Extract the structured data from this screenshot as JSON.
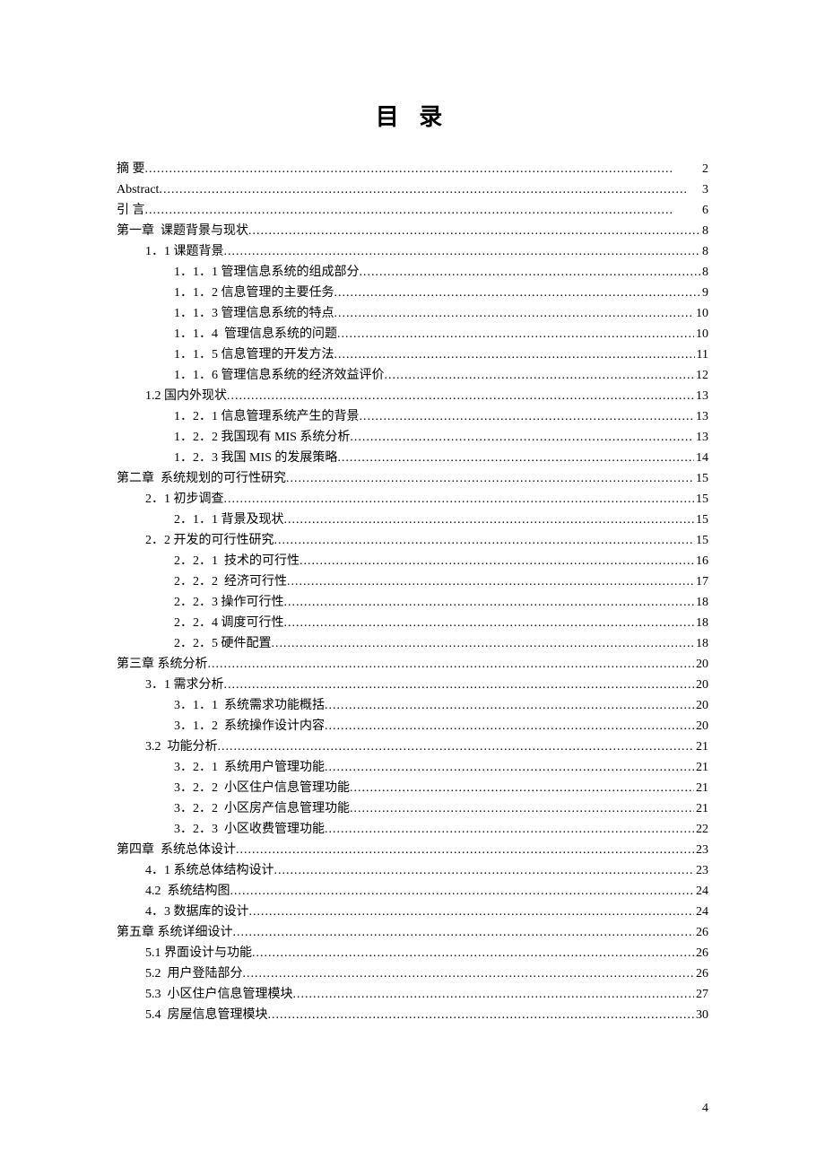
{
  "title": "目 录",
  "page_number": "4",
  "toc": [
    {
      "indent": 0,
      "label": "摘 要",
      "page": "2"
    },
    {
      "indent": 0,
      "label": "Abstract",
      "page": "3"
    },
    {
      "indent": 0,
      "label": "引 言",
      "page": "6"
    },
    {
      "indent": 0,
      "label": "第一章  课题背景与现状",
      "page": "8"
    },
    {
      "indent": 1,
      "label": "1．1 课题背景",
      "page": "8"
    },
    {
      "indent": 2,
      "label": "1．1．1 管理信息系统的组成部分",
      "page": "8"
    },
    {
      "indent": 2,
      "label": "1．1．2 信息管理的主要任务",
      "page": "9"
    },
    {
      "indent": 2,
      "label": "1．1．3 管理信息系统的特点",
      "page": "10"
    },
    {
      "indent": 2,
      "label": "1．1．4  管理信息系统的问题",
      "page": "10"
    },
    {
      "indent": 2,
      "label": "1．1．5 信息管理的开发方法",
      "page": "11"
    },
    {
      "indent": 2,
      "label": "1．1．6 管理信息系统的经济效益评价",
      "page": "12"
    },
    {
      "indent": 1,
      "label": "1.2 国内外现状",
      "page": "13"
    },
    {
      "indent": 2,
      "label": "1．2．1 信息管理系统产生的背景",
      "page": "13"
    },
    {
      "indent": 2,
      "label": "1．2．2 我国现有 MIS 系统分析",
      "page": "13"
    },
    {
      "indent": 2,
      "label": "1．2．3 我国 MIS 的发展策略",
      "page": "14"
    },
    {
      "indent": 0,
      "label": "第二章  系统规划的可行性研究",
      "page": "15"
    },
    {
      "indent": 1,
      "label": "2．1 初步调查",
      "page": "15"
    },
    {
      "indent": 2,
      "label": "2．1．1 背景及现状",
      "page": "15"
    },
    {
      "indent": 1,
      "label": "2．2 开发的可行性研究",
      "page": "15"
    },
    {
      "indent": 2,
      "label": "2．2．1  技术的可行性",
      "page": "16"
    },
    {
      "indent": 2,
      "label": "2．2．2  经济可行性",
      "page": "17"
    },
    {
      "indent": 2,
      "label": "2．2．3 操作可行性",
      "page": "18"
    },
    {
      "indent": 2,
      "label": "2．2．4 调度可行性",
      "page": "18"
    },
    {
      "indent": 2,
      "label": "2．2．5 硬件配置",
      "page": "18"
    },
    {
      "indent": 0,
      "label": "第三章 系统分析",
      "page": "20"
    },
    {
      "indent": 1,
      "label": "3．1 需求分析",
      "page": "20"
    },
    {
      "indent": 2,
      "label": "3．1．1  系统需求功能概括",
      "page": "20"
    },
    {
      "indent": 2,
      "label": "3．1．2  系统操作设计内容",
      "page": "20"
    },
    {
      "indent": 1,
      "label": "3.2  功能分析",
      "page": "21"
    },
    {
      "indent": 2,
      "label": "3．2．1  系统用户管理功能",
      "page": "21"
    },
    {
      "indent": 2,
      "label": "3．2．2  小区住户信息管理功能",
      "page": "21"
    },
    {
      "indent": 2,
      "label": "3．2．2  小区房产信息管理功能",
      "page": "21"
    },
    {
      "indent": 2,
      "label": "3．2．3  小区收费管理功能",
      "page": "22"
    },
    {
      "indent": 0,
      "label": "第四章  系统总体设计",
      "page": "23"
    },
    {
      "indent": 1,
      "label": "4．1 系统总体结构设计",
      "page": "23"
    },
    {
      "indent": 1,
      "label": "4.2  系统结构图",
      "page": "24"
    },
    {
      "indent": 1,
      "label": "4．3 数据库的设计",
      "page": "24"
    },
    {
      "indent": 0,
      "label": "第五章 系统详细设计",
      "page": "26"
    },
    {
      "indent": 1,
      "label": "5.1 界面设计与功能",
      "page": "26"
    },
    {
      "indent": 1,
      "label": "5.2  用户登陆部分",
      "page": "26"
    },
    {
      "indent": 1,
      "label": "5.3  小区住户信息管理模块",
      "page": "27"
    },
    {
      "indent": 1,
      "label": "5.4  房屋信息管理模块",
      "page": "30"
    }
  ]
}
